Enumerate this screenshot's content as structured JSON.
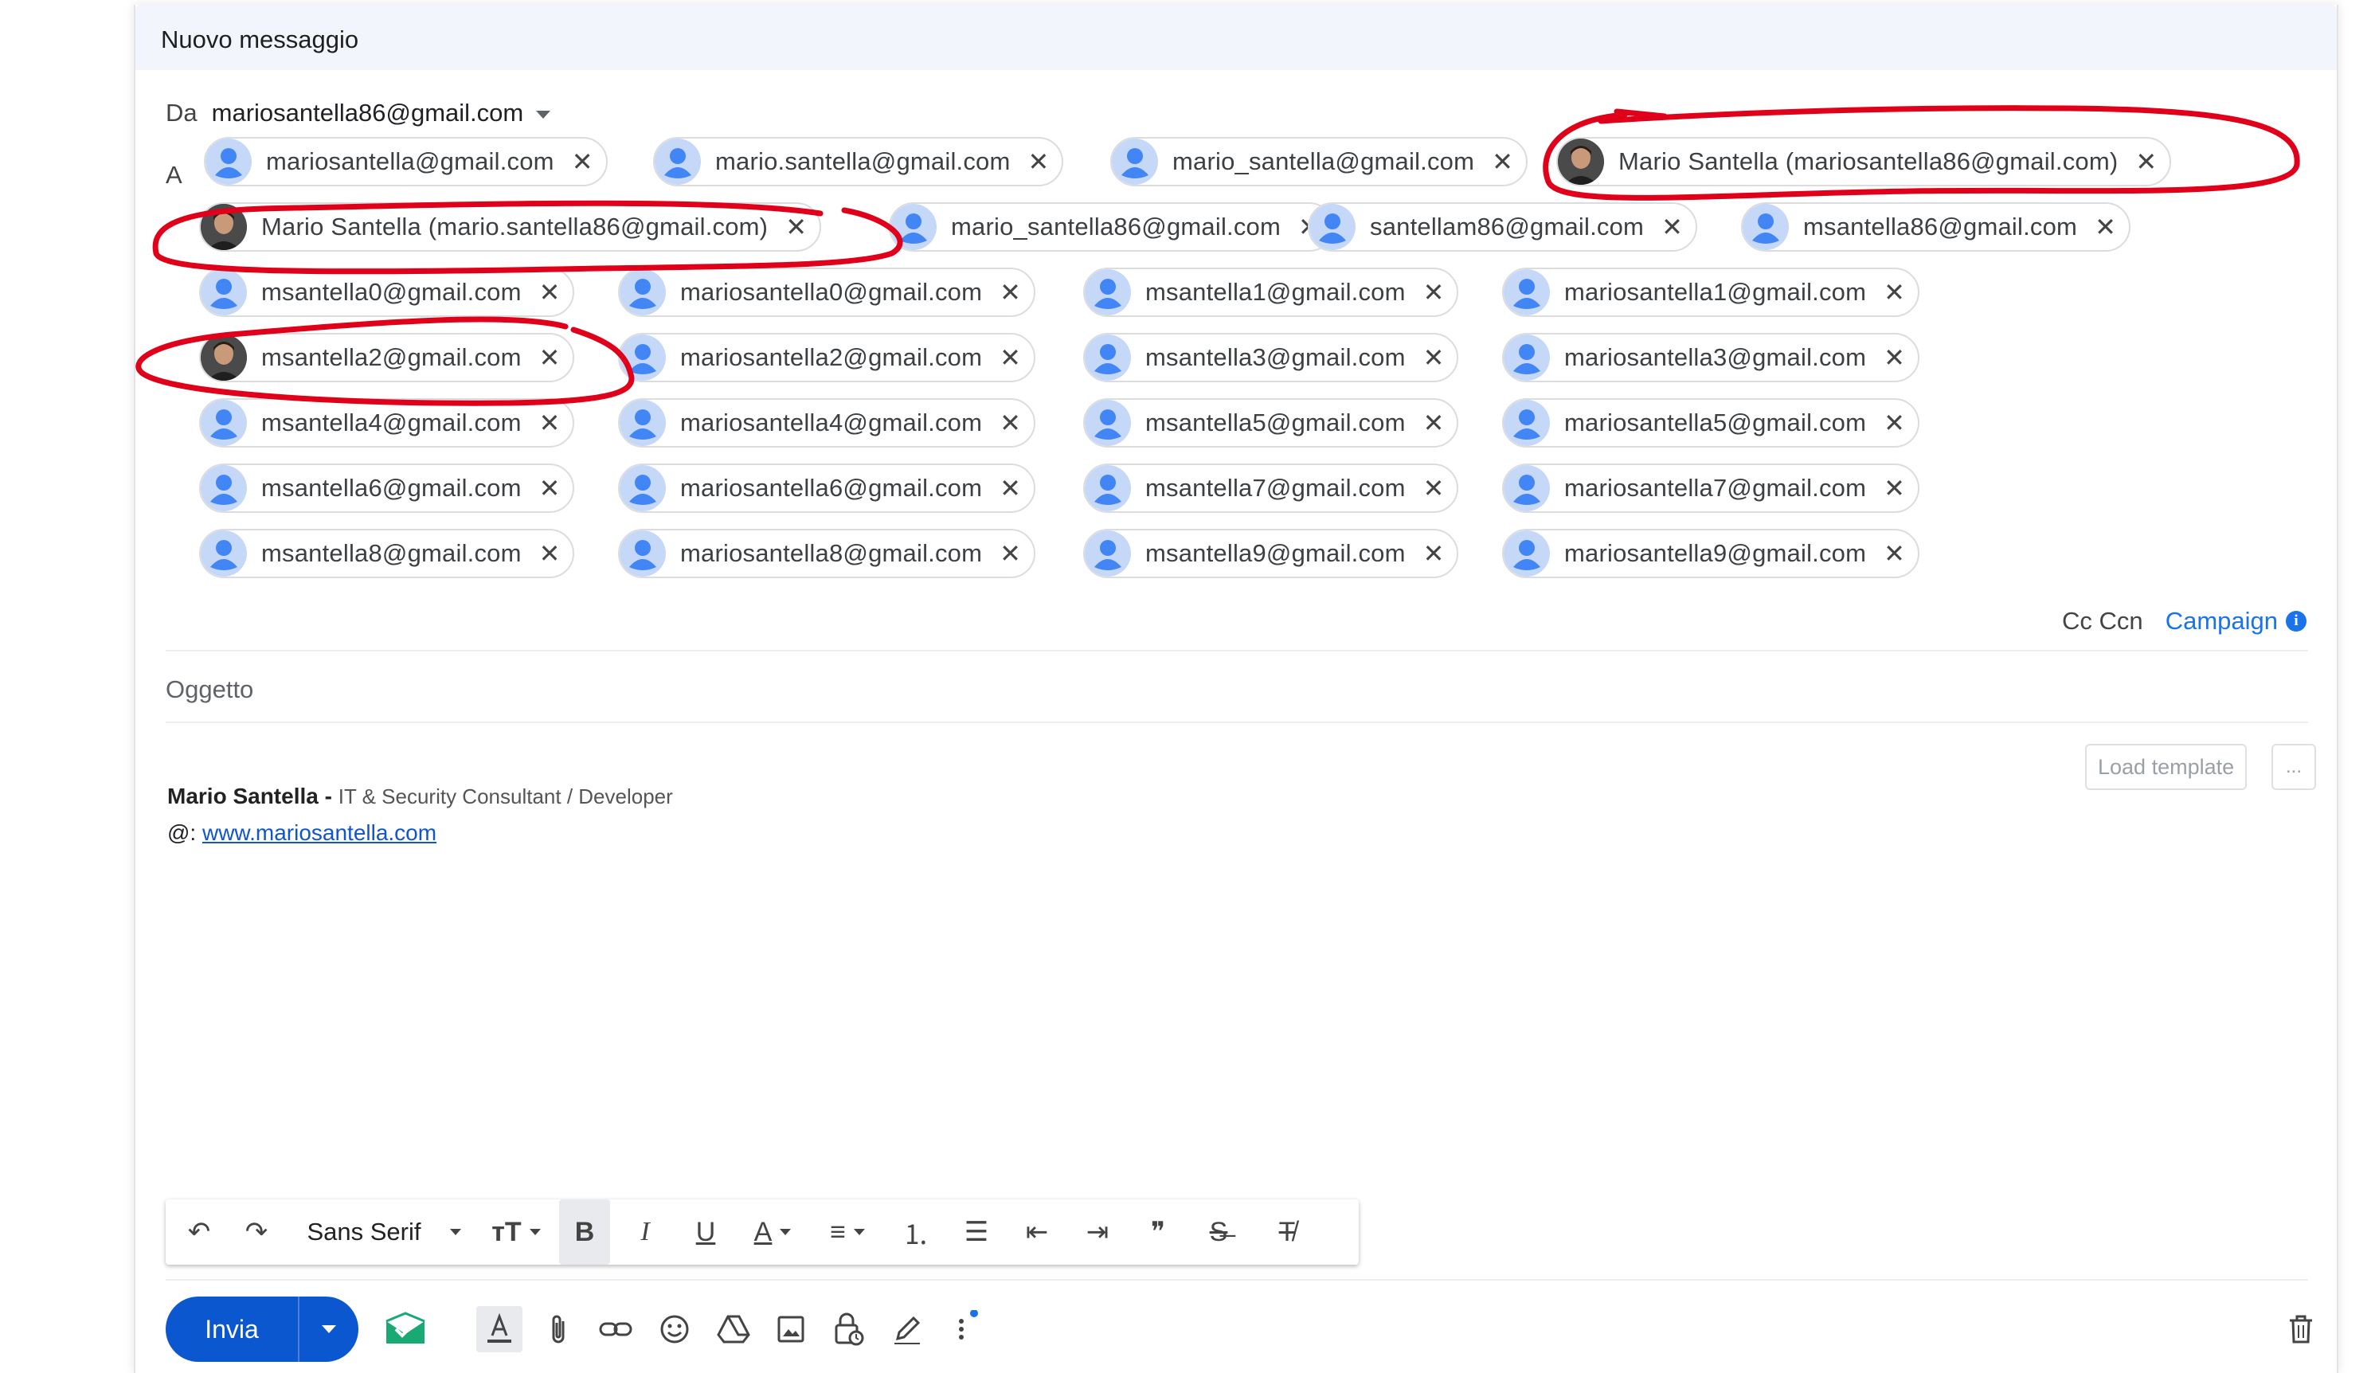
{
  "compose": {
    "title": "Nuovo messaggio",
    "from_label": "Da",
    "from_value": "mariosantella86@gmail.com",
    "to_label": "A",
    "recipients": [
      {
        "email": "mariosantella@gmail.com",
        "photo": false
      },
      {
        "email": "mario.santella@gmail.com",
        "photo": false
      },
      {
        "email": "mario_santella@gmail.com",
        "photo": false
      },
      {
        "email": "Mario Santella (mariosantella86@gmail.com)",
        "photo": true
      },
      {
        "email": "Mario Santella (mario.santella86@gmail.com)",
        "photo": true
      },
      {
        "email": "mario_santella86@gmail.com",
        "photo": false
      },
      {
        "email": "santellam86@gmail.com",
        "photo": false
      },
      {
        "email": "msantella86@gmail.com",
        "photo": false
      },
      {
        "email": "msantella0@gmail.com",
        "photo": false
      },
      {
        "email": "mariosantella0@gmail.com",
        "photo": false
      },
      {
        "email": "msantella1@gmail.com",
        "photo": false
      },
      {
        "email": "mariosantella1@gmail.com",
        "photo": false
      },
      {
        "email": "msantella2@gmail.com",
        "photo": true
      },
      {
        "email": "mariosantella2@gmail.com",
        "photo": false
      },
      {
        "email": "msantella3@gmail.com",
        "photo": false
      },
      {
        "email": "mariosantella3@gmail.com",
        "photo": false
      },
      {
        "email": "msantella4@gmail.com",
        "photo": false
      },
      {
        "email": "mariosantella4@gmail.com",
        "photo": false
      },
      {
        "email": "msantella5@gmail.com",
        "photo": false
      },
      {
        "email": "mariosantella5@gmail.com",
        "photo": false
      },
      {
        "email": "msantella6@gmail.com",
        "photo": false
      },
      {
        "email": "mariosantella6@gmail.com",
        "photo": false
      },
      {
        "email": "msantella7@gmail.com",
        "photo": false
      },
      {
        "email": "mariosantella7@gmail.com",
        "photo": false
      },
      {
        "email": "msantella8@gmail.com",
        "photo": false
      },
      {
        "email": "mariosantella8@gmail.com",
        "photo": false
      },
      {
        "email": "msantella9@gmail.com",
        "photo": false
      },
      {
        "email": "mariosantella9@gmail.com",
        "photo": false
      }
    ],
    "cc_label": "Cc",
    "bcc_label": "Ccn",
    "campaign_label": "Campaign",
    "info_glyph": "i",
    "subject_placeholder": "Oggetto",
    "load_template_label": "Load template",
    "more_label": "...",
    "signature": {
      "name": "Mario Santella",
      "separator": " - ",
      "role": "IT & Security Consultant / Developer",
      "web_prefix": "@: ",
      "web_link": "www.mariosantella.com"
    },
    "toolbar": {
      "font_name": "Sans Serif",
      "undo": "↶",
      "redo": "↷",
      "size": "тT",
      "bold": "B",
      "italic": "I",
      "underline": "U",
      "textcolor": "A",
      "align": "≡",
      "numbered": "⒈",
      "bullets": "☰",
      "indent_less": "⇤",
      "indent_more": "⇥",
      "quote": "❞",
      "strike": "S̶",
      "clear": "T̸"
    },
    "send_label": "Invia",
    "accent": "#0b57d0",
    "annotation_color": "#e0001a"
  }
}
